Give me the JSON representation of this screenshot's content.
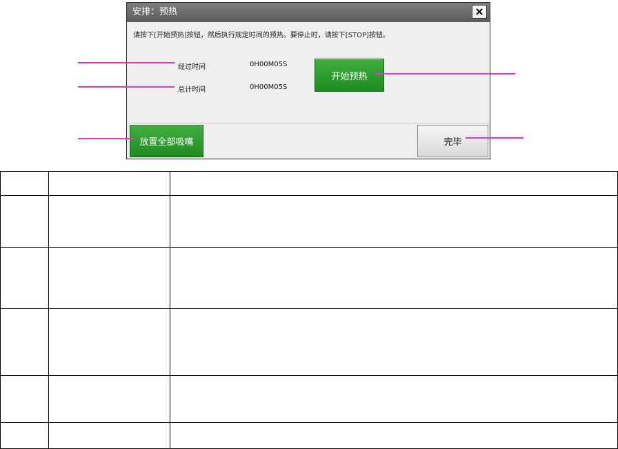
{
  "dialog": {
    "title": "安排：预热",
    "instruction": "请按下[开始预热]按钮，然后执行规定时间的预热。要停止时，请按下[STOP]按钮。",
    "elapsed_label": "经过时间",
    "elapsed_value": "0H00M05S",
    "total_label": "总计时间",
    "total_value": "0H00M05S",
    "start_button": "开始预热",
    "place_all_button": "放置全部吸嘴",
    "done_button": "完毕",
    "close_icon": "close-icon"
  },
  "colors": {
    "callout": "#e636c8",
    "green_button": "#2a9a2a",
    "titlebar": "#6b6b6b"
  },
  "table": {
    "rows": [
      [
        "",
        "",
        ""
      ],
      [
        "",
        "",
        ""
      ],
      [
        "",
        "",
        ""
      ],
      [
        "",
        "",
        ""
      ],
      [
        "",
        "",
        ""
      ],
      [
        "",
        "",
        ""
      ]
    ]
  }
}
